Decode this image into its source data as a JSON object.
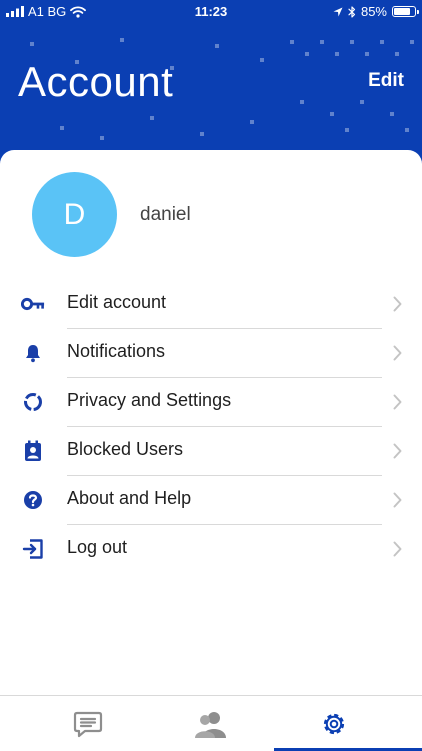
{
  "status_bar": {
    "carrier": "A1 BG",
    "time": "11:23",
    "battery": "85%",
    "battery_level": 0.85
  },
  "header": {
    "title": "Account",
    "edit_label": "Edit"
  },
  "profile": {
    "initial": "D",
    "name": "daniel"
  },
  "menu": [
    {
      "label": "Edit account",
      "icon": "key-icon"
    },
    {
      "label": "Notifications",
      "icon": "bell-icon"
    },
    {
      "label": "Privacy and Settings",
      "icon": "privacy-icon"
    },
    {
      "label": "Blocked Users",
      "icon": "blocked-user-icon"
    },
    {
      "label": "About and Help",
      "icon": "help-icon"
    },
    {
      "label": "Log out",
      "icon": "logout-icon"
    }
  ],
  "tabs": [
    {
      "name": "chats",
      "icon": "chat-icon"
    },
    {
      "name": "contacts",
      "icon": "contacts-icon"
    },
    {
      "name": "settings",
      "icon": "gear-icon",
      "active": true
    }
  ],
  "colors": {
    "primary": "#0b3fb3",
    "avatar": "#5ac3f6",
    "icon": "#1a3fa8",
    "chevron": "#c4c4c4",
    "tab_inactive": "#8e8e8e"
  }
}
